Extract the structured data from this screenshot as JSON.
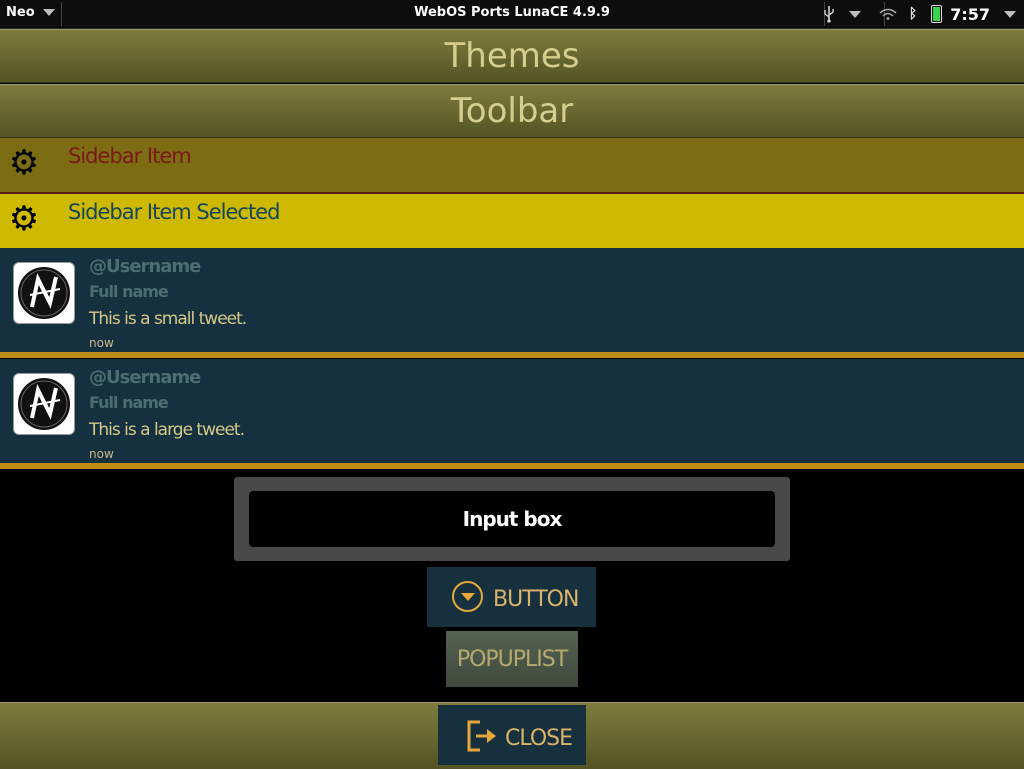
{
  "status_bar": {
    "app_menu": "Neo",
    "title": "WebOS Ports LunaCE 4.9.9",
    "time": "7:57",
    "icons": [
      "usb-icon",
      "menu-arrow-icon",
      "wifi-icon",
      "bluetooth-icon",
      "battery-icon",
      "menu-arrow-icon"
    ]
  },
  "headers": {
    "themes": "Themes",
    "toolbar": "Toolbar"
  },
  "sidebar": {
    "items": [
      {
        "label": "Sidebar Item",
        "icon": "gear-icon"
      },
      {
        "label": "Sidebar Item Selected",
        "icon": "gear-icon"
      }
    ]
  },
  "tweets": [
    {
      "username": "@Username",
      "fullname": "Full name",
      "text": "This is a small tweet.",
      "time": "now"
    },
    {
      "username": "@Username",
      "fullname": "Full name",
      "text": "This is a large tweet.",
      "time": "now"
    }
  ],
  "input": {
    "placeholder": "Input box"
  },
  "buttons": {
    "button": "BUTTON",
    "popuplist": "POPUPLIST",
    "close": "CLOSE"
  },
  "colors": {
    "header": "#6b6a33",
    "header_text": "#d4cf8e",
    "sidebar_item_bg": "#7c6d14",
    "sidebar_item_text": "#7a1a14",
    "sidebar_selected_bg": "#cfb800",
    "sidebar_selected_text": "#15475a",
    "tweet_bg": "#15303e",
    "tweet_separator": "#bf8c18",
    "button_bg": "#16303e",
    "button_text": "#d9b36a"
  }
}
